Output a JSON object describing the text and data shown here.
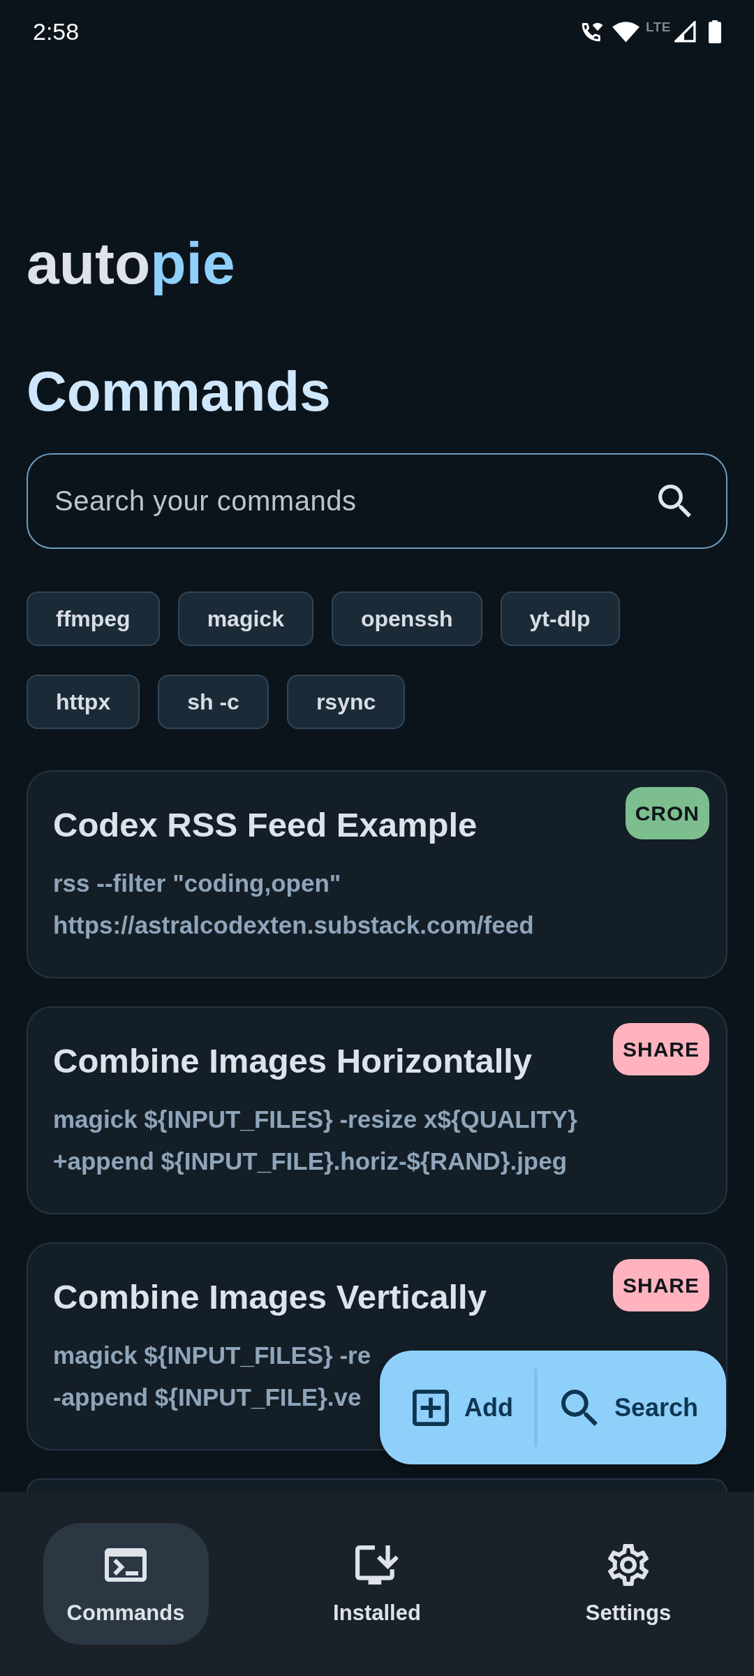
{
  "status_bar": {
    "time": "2:58",
    "network": "LTE"
  },
  "logo": {
    "text": "auto",
    "accent": "pie"
  },
  "title": "Commands",
  "search": {
    "placeholder": "Search your commands"
  },
  "filter_chips": [
    {
      "label": "ffmpeg",
      "selected": false
    },
    {
      "label": "magick",
      "selected": false
    },
    {
      "label": "openssh",
      "selected": false
    },
    {
      "label": "yt-dlp",
      "selected": false
    },
    {
      "label": "httpx",
      "selected": false
    },
    {
      "label": "sh -c",
      "selected": false
    },
    {
      "label": "rsync",
      "selected": false
    }
  ],
  "commands": [
    {
      "title": "Codex RSS Feed Example",
      "tag": {
        "label": "CRON",
        "color": "#7dbe8f"
      },
      "command_lines": [
        "rss --filter \"coding,open\"",
        "https://astralcodexten.substack.com/feed"
      ]
    },
    {
      "title": "Combine Images Horizontally",
      "tag": {
        "label": "SHARE",
        "color": "#ffb3be"
      },
      "command_lines": [
        "magick ${INPUT_FILES} -resize x${QUALITY}",
        "+append ${INPUT_FILE}.horiz-${RAND}.jpeg"
      ]
    },
    {
      "title": "Combine Images Vertically",
      "tag": {
        "label": "SHARE",
        "color": "#ffb3be"
      },
      "command_lines": [
        "magick ${INPUT_FILES} -re",
        "-append ${INPUT_FILE}.ve"
      ]
    }
  ],
  "fab_actions": [
    {
      "label": "Add"
    },
    {
      "label": "Search"
    }
  ],
  "bottom_nav": [
    {
      "label": "Commands",
      "selected": true
    },
    {
      "label": "Installed",
      "selected": false
    },
    {
      "label": "Settings",
      "selected": false
    }
  ]
}
